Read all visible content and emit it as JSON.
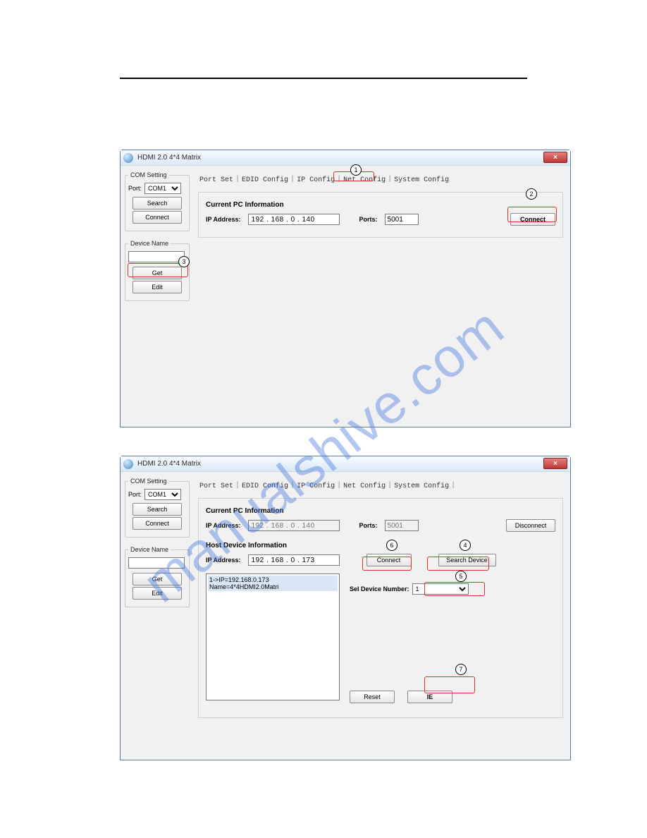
{
  "watermark": "manualshive.com",
  "window_title": "HDMI 2.0 4*4 Matrix",
  "close_glyph": "×",
  "com_setting": {
    "legend": "COM Setting",
    "port_label": "Port:",
    "port_value": "COM1",
    "search_btn": "Search",
    "connect_btn": "Connect"
  },
  "device_name": {
    "legend": "Device Name",
    "value": "",
    "get_btn": "Get",
    "edit_btn": "Edit"
  },
  "tabs": {
    "port_set": "Port Set",
    "edid_config": "EDID Config",
    "ip_config": "IP Config",
    "net_config": "Net Config",
    "system_config": "System Config"
  },
  "shot1": {
    "pc_info_title": "Current PC Information",
    "ip_label": "IP Address:",
    "ip_value": "192 . 168 .  0  . 140",
    "ports_label": "Ports:",
    "ports_value": "5001",
    "connect_btn": "Connect"
  },
  "shot2": {
    "pc_info_title": "Current PC Information",
    "ip_label": "IP Address:",
    "ip_value": "192 . 168 .  0  . 140",
    "ports_label": "Ports:",
    "ports_value": "5001",
    "disconnect_btn": "Disconnect",
    "host_title": "Host Device Information",
    "host_ip_label": "IP Address:",
    "host_ip_value": "192 . 168 .  0  . 173",
    "connect_btn": "Connect",
    "search_device_btn": "Search Device",
    "list_item": "1->IP=192.168.0.173   Name=4*4HDMI2.0Matri",
    "sel_label": "Sel Device Number:",
    "sel_value": "1",
    "reset_btn": "Reset",
    "ie_btn": "IE"
  },
  "callouts": {
    "c1": "1",
    "c2": "2",
    "c3": "3",
    "c4": "4",
    "c5": "5",
    "c6": "6",
    "c7": "7"
  }
}
